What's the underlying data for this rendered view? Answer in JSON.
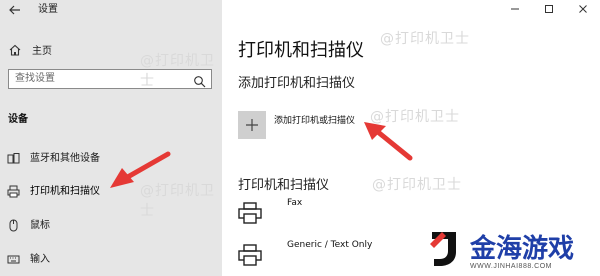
{
  "window": {
    "title": "设置"
  },
  "sidebar": {
    "home_label": "主页",
    "search_placeholder": "查找设置",
    "section_label": "设备",
    "items": [
      {
        "label": "蓝牙和其他设备",
        "icon": "bluetooth-devices-icon"
      },
      {
        "label": "打印机和扫描仪",
        "icon": "printer-icon",
        "active": true
      },
      {
        "label": "鼠标",
        "icon": "mouse-icon"
      },
      {
        "label": "输入",
        "icon": "keyboard-icon"
      }
    ]
  },
  "main": {
    "title": "打印机和扫描仪",
    "add_section_label": "添加打印机和扫描仪",
    "add_button_label": "添加打印机或扫描仪",
    "list_section_label": "打印机和扫描仪",
    "printers": [
      {
        "name": "Fax"
      },
      {
        "name": "Generic / Text Only"
      }
    ]
  },
  "watermark": {
    "text": "@打印机卫士"
  },
  "logo": {
    "brand": "金海游戏",
    "url": "WWW.JINHAI888.COM"
  },
  "colors": {
    "sidebar_bg": "#e6e6e6",
    "annotation_red": "#e53935",
    "brand_blue": "#1f3fa8"
  }
}
